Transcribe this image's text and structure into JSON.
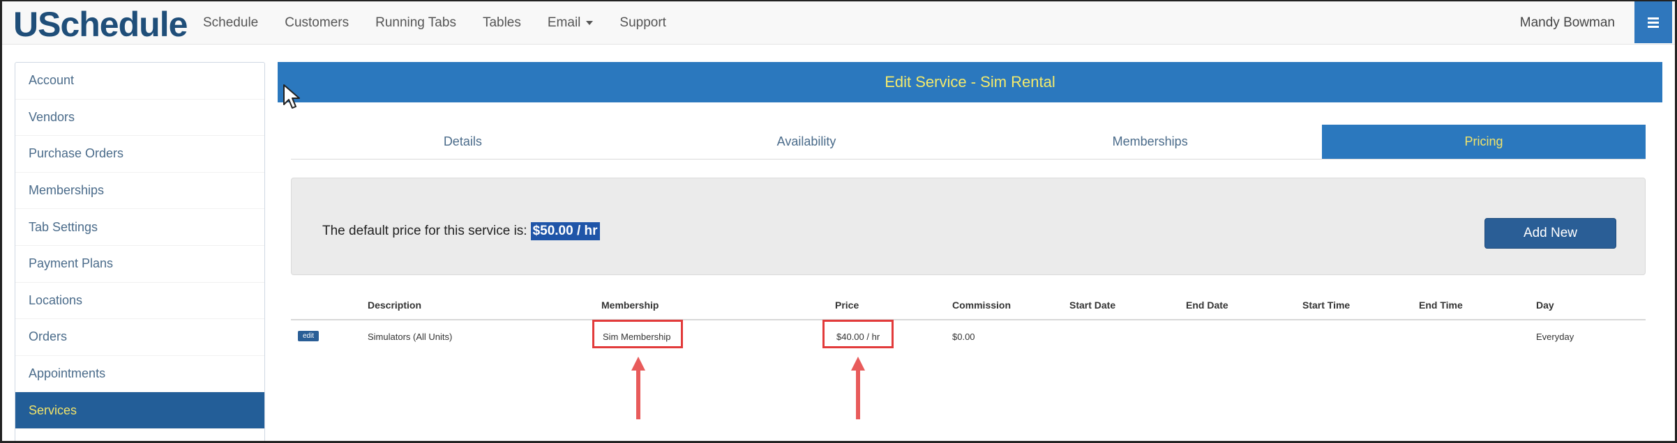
{
  "app": {
    "brand": "USchedule",
    "nav": [
      {
        "label": "Schedule"
      },
      {
        "label": "Customers"
      },
      {
        "label": "Running Tabs"
      },
      {
        "label": "Tables"
      },
      {
        "label": "Email",
        "has_dropdown": true
      },
      {
        "label": "Support"
      }
    ],
    "user": "Mandy Bowman",
    "menu_icon": "hamburger-icon"
  },
  "sidebar": {
    "items": [
      {
        "label": "Account"
      },
      {
        "label": "Vendors"
      },
      {
        "label": "Purchase Orders"
      },
      {
        "label": "Memberships"
      },
      {
        "label": "Tab Settings"
      },
      {
        "label": "Payment Plans"
      },
      {
        "label": "Locations"
      },
      {
        "label": "Orders"
      },
      {
        "label": "Appointments"
      },
      {
        "label": "Services",
        "active": true
      }
    ]
  },
  "page": {
    "title": "Edit Service - Sim Rental",
    "tabs": [
      {
        "label": "Details"
      },
      {
        "label": "Availability"
      },
      {
        "label": "Memberships"
      },
      {
        "label": "Pricing",
        "active": true
      }
    ],
    "default_price_text": "The default price for this service is:",
    "default_price_value": "$50.00 / hr",
    "add_new_label": "Add New"
  },
  "table": {
    "headers": {
      "description": "Description",
      "membership": "Membership",
      "price": "Price",
      "commission": "Commission",
      "start_date": "Start Date",
      "end_date": "End Date",
      "start_time": "Start Time",
      "end_time": "End Time",
      "day": "Day"
    },
    "rows": [
      {
        "edit_label": "edit",
        "description": "Simulators (All Units)",
        "membership": "Sim Membership",
        "price": "$40.00 / hr",
        "commission": "$0.00",
        "start_date": "",
        "end_date": "",
        "start_time": "",
        "end_time": "",
        "day": "Everyday"
      }
    ]
  },
  "colors": {
    "accent_blue": "#2b78be",
    "highlight_yellow": "#f2e46a",
    "annotation_red": "#e23b3b"
  }
}
